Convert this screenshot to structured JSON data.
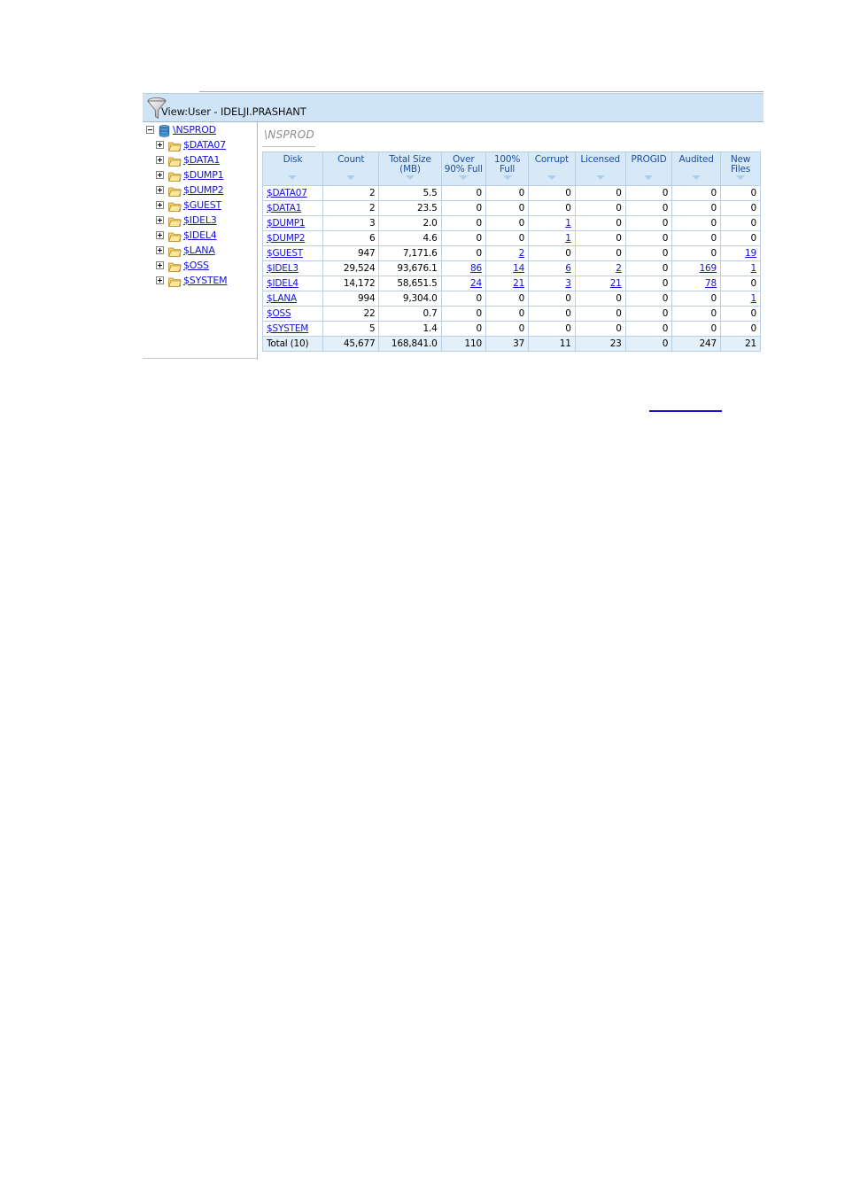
{
  "window": {
    "filter_bar": {
      "icon": "funnel-filter-icon",
      "label": "View:User - IDELJI.PRASHANT"
    }
  },
  "tree": {
    "root": {
      "label": "\\NSPROD",
      "icon": "database-icon",
      "expander": "minus",
      "expanded": true
    },
    "children": [
      {
        "label": "$DATA07",
        "icon": "folder-icon",
        "expander": "plus"
      },
      {
        "label": "$DATA1",
        "icon": "folder-icon",
        "expander": "plus"
      },
      {
        "label": "$DUMP1",
        "icon": "folder-icon",
        "expander": "plus"
      },
      {
        "label": "$DUMP2",
        "icon": "folder-icon",
        "expander": "plus"
      },
      {
        "label": "$GUEST",
        "icon": "folder-icon",
        "expander": "plus"
      },
      {
        "label": "$IDEL3",
        "icon": "folder-icon",
        "expander": "plus"
      },
      {
        "label": "$IDEL4",
        "icon": "folder-icon",
        "expander": "plus"
      },
      {
        "label": "$LANA",
        "icon": "folder-icon",
        "expander": "plus"
      },
      {
        "label": "$OSS",
        "icon": "folder-icon",
        "expander": "plus"
      },
      {
        "label": "$SYSTEM",
        "icon": "folder-icon",
        "expander": "plus"
      }
    ]
  },
  "content": {
    "title": "\\NSPROD"
  },
  "chart_data": {
    "type": "table",
    "title": "\\NSPROD",
    "columns": [
      {
        "label": "Disk",
        "lines": [
          "Disk"
        ],
        "sortable": true,
        "align": "left"
      },
      {
        "label": "Count",
        "lines": [
          "Count"
        ],
        "sortable": true,
        "align": "right"
      },
      {
        "label": "Total Size (MB)",
        "lines": [
          "Total Size",
          "(MB)"
        ],
        "sortable": true,
        "align": "right"
      },
      {
        "label": "Over 90% Full",
        "lines": [
          "Over",
          "90% Full"
        ],
        "sortable": true,
        "align": "right"
      },
      {
        "label": "100% Full",
        "lines": [
          "100%",
          "Full"
        ],
        "sortable": true,
        "align": "right"
      },
      {
        "label": "Corrupt",
        "lines": [
          "Corrupt"
        ],
        "sortable": true,
        "align": "right"
      },
      {
        "label": "Licensed",
        "lines": [
          "Licensed"
        ],
        "sortable": true,
        "align": "right"
      },
      {
        "label": "PROGID",
        "lines": [
          "PROGID"
        ],
        "sortable": true,
        "align": "right"
      },
      {
        "label": "Audited",
        "lines": [
          "Audited"
        ],
        "sortable": true,
        "align": "right"
      },
      {
        "label": "New Files",
        "lines": [
          "New",
          "Files"
        ],
        "sortable": true,
        "align": "right"
      }
    ],
    "rows": [
      {
        "disk": "$DATA07",
        "count": "2",
        "total_size_mb": "5.5",
        "over_90_full": "0",
        "full_100": "0",
        "corrupt": "0",
        "licensed": "0",
        "progid": "0",
        "audited": "0",
        "new_files": "0",
        "links": {
          "disk": true,
          "over_90_full": false,
          "full_100": false,
          "corrupt": false,
          "licensed": false,
          "progid": false,
          "audited": false,
          "new_files": false
        }
      },
      {
        "disk": "$DATA1",
        "count": "2",
        "total_size_mb": "23.5",
        "over_90_full": "0",
        "full_100": "0",
        "corrupt": "0",
        "licensed": "0",
        "progid": "0",
        "audited": "0",
        "new_files": "0",
        "links": {
          "disk": true,
          "over_90_full": false,
          "full_100": false,
          "corrupt": false,
          "licensed": false,
          "progid": false,
          "audited": false,
          "new_files": false
        }
      },
      {
        "disk": "$DUMP1",
        "count": "3",
        "total_size_mb": "2.0",
        "over_90_full": "0",
        "full_100": "0",
        "corrupt": "1",
        "licensed": "0",
        "progid": "0",
        "audited": "0",
        "new_files": "0",
        "links": {
          "disk": true,
          "over_90_full": false,
          "full_100": false,
          "corrupt": true,
          "licensed": false,
          "progid": false,
          "audited": false,
          "new_files": false
        }
      },
      {
        "disk": "$DUMP2",
        "count": "6",
        "total_size_mb": "4.6",
        "over_90_full": "0",
        "full_100": "0",
        "corrupt": "1",
        "licensed": "0",
        "progid": "0",
        "audited": "0",
        "new_files": "0",
        "links": {
          "disk": true,
          "over_90_full": false,
          "full_100": false,
          "corrupt": true,
          "licensed": false,
          "progid": false,
          "audited": false,
          "new_files": false
        }
      },
      {
        "disk": "$GUEST",
        "count": "947",
        "total_size_mb": "7,171.6",
        "over_90_full": "0",
        "full_100": "2",
        "corrupt": "0",
        "licensed": "0",
        "progid": "0",
        "audited": "0",
        "new_files": "19",
        "links": {
          "disk": true,
          "over_90_full": false,
          "full_100": true,
          "corrupt": false,
          "licensed": false,
          "progid": false,
          "audited": false,
          "new_files": true
        }
      },
      {
        "disk": "$IDEL3",
        "count": "29,524",
        "total_size_mb": "93,676.1",
        "over_90_full": "86",
        "full_100": "14",
        "corrupt": "6",
        "licensed": "2",
        "progid": "0",
        "audited": "169",
        "new_files": "1",
        "links": {
          "disk": true,
          "over_90_full": true,
          "full_100": true,
          "corrupt": true,
          "licensed": true,
          "progid": false,
          "audited": true,
          "new_files": true
        }
      },
      {
        "disk": "$IDEL4",
        "count": "14,172",
        "total_size_mb": "58,651.5",
        "over_90_full": "24",
        "full_100": "21",
        "corrupt": "3",
        "licensed": "21",
        "progid": "0",
        "audited": "78",
        "new_files": "0",
        "links": {
          "disk": true,
          "over_90_full": true,
          "full_100": true,
          "corrupt": true,
          "licensed": true,
          "progid": false,
          "audited": true,
          "new_files": false
        }
      },
      {
        "disk": "$LANA",
        "count": "994",
        "total_size_mb": "9,304.0",
        "over_90_full": "0",
        "full_100": "0",
        "corrupt": "0",
        "licensed": "0",
        "progid": "0",
        "audited": "0",
        "new_files": "1",
        "links": {
          "disk": true,
          "over_90_full": false,
          "full_100": false,
          "corrupt": false,
          "licensed": false,
          "progid": false,
          "audited": false,
          "new_files": true
        }
      },
      {
        "disk": "$OSS",
        "count": "22",
        "total_size_mb": "0.7",
        "over_90_full": "0",
        "full_100": "0",
        "corrupt": "0",
        "licensed": "0",
        "progid": "0",
        "audited": "0",
        "new_files": "0",
        "links": {
          "disk": true,
          "over_90_full": false,
          "full_100": false,
          "corrupt": false,
          "licensed": false,
          "progid": false,
          "audited": false,
          "new_files": false
        }
      },
      {
        "disk": "$SYSTEM",
        "count": "5",
        "total_size_mb": "1.4",
        "over_90_full": "0",
        "full_100": "0",
        "corrupt": "0",
        "licensed": "0",
        "progid": "0",
        "audited": "0",
        "new_files": "0",
        "links": {
          "disk": true,
          "over_90_full": false,
          "full_100": false,
          "corrupt": false,
          "licensed": false,
          "progid": false,
          "audited": false,
          "new_files": false
        }
      }
    ],
    "total_row": {
      "disk": "Total (10)",
      "count": "45,677",
      "total_size_mb": "168,841.0",
      "over_90_full": "110",
      "full_100": "37",
      "corrupt": "11",
      "licensed": "23",
      "progid": "0",
      "audited": "247",
      "new_files": "21"
    }
  },
  "colors": {
    "filter_bar_bg": "#cfe4f7",
    "header_bg": "#d7e8f7",
    "header_text": "#1d4f9e",
    "total_row_bg": "#e3eff9",
    "link": "#1414cd",
    "grid_border": "#b9cfe4",
    "content_title": "#8a8a8a"
  }
}
